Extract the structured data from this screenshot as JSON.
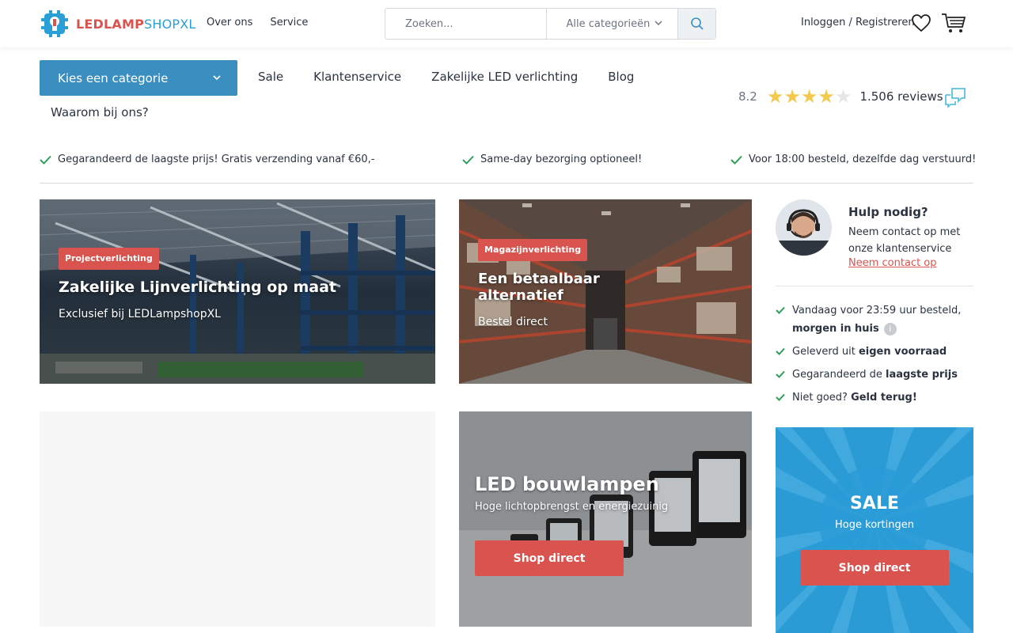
{
  "header": {
    "logo_part1": "LEDLAMP",
    "logo_part2": "SHOPXL",
    "nav": [
      "Over ons",
      "Service"
    ],
    "search_placeholder": "Zoeken...",
    "search_category": "Alle categorieën",
    "account_label": "Inloggen / Registreren"
  },
  "category_bar": {
    "button_label": "Kies een categorie",
    "nav": [
      "Sale",
      "Klantenservice",
      "Zakelijke LED verlichting",
      "Blog"
    ],
    "why_label": "Waarom bij ons?"
  },
  "rating": {
    "score": "8.2",
    "stars_filled": 4,
    "stars_total": 5,
    "reviews": "1.506 reviews"
  },
  "usps": [
    "Gegarandeerd de laagste prijs! Gratis verzending vanaf €60,-",
    "Same-day bezorging optioneel!",
    "Voor 18:00 besteld, dezelfde dag verstuurd!"
  ],
  "tiles": {
    "project": {
      "badge": "Projectverlichting",
      "title": "Zakelijke Lijnverlichting op maat",
      "subtitle": "Exclusief bij LEDLampshopXL"
    },
    "warehouse": {
      "badge": "Magazijnverlichting",
      "title_line1": "Een betaalbaar",
      "title_line2": "alternatief",
      "subtitle": "Bestel direct"
    },
    "bouwlampen": {
      "title": "LED bouwlampen",
      "subtitle": "Hoge lichtopbrengst en energiezuinig",
      "button": "Shop direct"
    },
    "sale": {
      "title": "SALE",
      "subtitle": "Hoge kortingen",
      "button": "Shop direct"
    }
  },
  "help": {
    "title": "Hulp nodig?",
    "text": "Neem contact op met onze klantenservice",
    "link": "Neem contact op"
  },
  "benefits": [
    {
      "pre": "Vandaag voor 23:59 uur besteld,",
      "bold": "morgen in huis",
      "post": ""
    },
    {
      "pre": "Geleverd uit ",
      "bold": "eigen voorraad",
      "post": ""
    },
    {
      "pre": "Gegarandeerd de ",
      "bold": "laagste prijs",
      "post": ""
    },
    {
      "pre": "Niet goed? ",
      "bold": "Geld terug!",
      "post": ""
    }
  ],
  "colors": {
    "brand_red": "#d9534f",
    "brand_blue": "#3b8fc0",
    "check_green": "#2e9e5b",
    "star_yellow": "#f2c94c"
  }
}
